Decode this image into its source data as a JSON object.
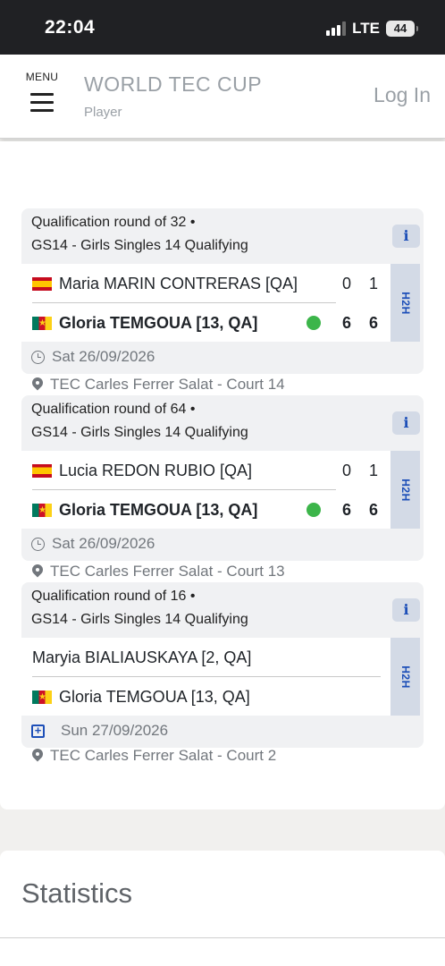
{
  "status_bar": {
    "time": "22:04",
    "network": "LTE",
    "battery": "44"
  },
  "header": {
    "menu_label": "MENU",
    "title": "WORLD TEC CUP",
    "subtitle": "Player",
    "login_label": "Log In"
  },
  "matches": [
    {
      "round": "Qualification round of 32 •",
      "event": "GS14 - Girls Singles 14 Qualifying",
      "info_label": "i",
      "h2h_label": "H2H",
      "player1": {
        "name": "Maria MARIN CONTRERAS [QA]",
        "flag": "spain-flag",
        "set1": "0",
        "set2": "1"
      },
      "player2": {
        "name": "Gloria TEMGOUA [13, QA]",
        "flag": "cameroon-flag",
        "set1": "6",
        "set2": "6"
      },
      "date": "Sat 26/09/2026",
      "venue": "TEC Carles Ferrer Salat - Court 14"
    },
    {
      "round": "Qualification round of 64 •",
      "event": "GS14 - Girls Singles 14 Qualifying",
      "info_label": "i",
      "h2h_label": "H2H",
      "player1": {
        "name": "Lucia REDON RUBIO [QA]",
        "flag": "spain-flag",
        "set1": "0",
        "set2": "1"
      },
      "player2": {
        "name": "Gloria TEMGOUA [13, QA]",
        "flag": "cameroon-flag",
        "set1": "6",
        "set2": "6"
      },
      "date": "Sat 26/09/2026",
      "venue": "TEC Carles Ferrer Salat - Court 13"
    },
    {
      "round": "Qualification round of 16 •",
      "event": "GS14 - Girls Singles 14 Qualifying",
      "info_label": "i",
      "h2h_label": "H2H",
      "player1": {
        "name": "Maryia BIALIAUSKAYA [2, QA]"
      },
      "player2": {
        "name": "Gloria TEMGOUA [13, QA]",
        "flag": "cameroon-flag"
      },
      "date": "Sun 27/09/2026",
      "venue": "TEC Carles Ferrer Salat - Court 2"
    }
  ],
  "statistics": {
    "title": "Statistics"
  },
  "colors": {
    "winner_dot": "#3cb54a",
    "accent_blue": "#1d4fb8",
    "h2h_bg": "#d3dae6",
    "card_bg": "#f0f1f3"
  }
}
